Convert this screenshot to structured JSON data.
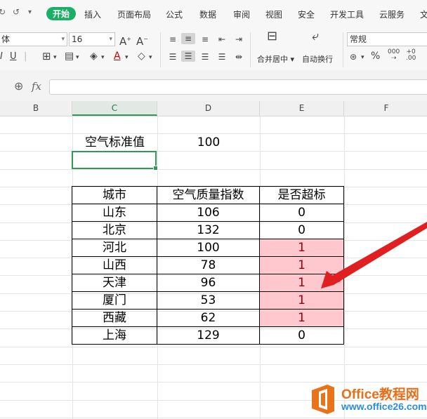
{
  "colors": {
    "accent_green": "#1aae66",
    "selection_green": "#2f9a54",
    "highlight_fill": "#ffc7ce",
    "highlight_text": "#9c0006",
    "arrow_red": "#e02020"
  },
  "menubar": {
    "tabs": [
      {
        "label": "开始",
        "active": true
      },
      {
        "label": "插入"
      },
      {
        "label": "页面布局"
      },
      {
        "label": "公式"
      },
      {
        "label": "数据"
      },
      {
        "label": "审阅"
      },
      {
        "label": "视图"
      },
      {
        "label": "安全"
      },
      {
        "label": "开发工具"
      },
      {
        "label": "云服务"
      },
      {
        "label": "文"
      }
    ]
  },
  "ribbon": {
    "font_name": "体",
    "font_size": "16",
    "merge_center_label": "合并居中",
    "auto_wrap_label": "自动换行",
    "number_format": "常规",
    "percent_symbol": "%"
  },
  "formula_bar": {
    "fx_label": "fx",
    "value": ""
  },
  "columns": [
    "B",
    "C",
    "D",
    "E",
    "F"
  ],
  "selected_column": "C",
  "sheet": {
    "threshold_label": "空气标准值",
    "threshold_value": "100",
    "table": {
      "headers": [
        "城市",
        "空气质量指数",
        "是否超标"
      ],
      "rows": [
        {
          "city": "山东",
          "aqi": "106",
          "flag": "0",
          "highlight": false
        },
        {
          "city": "北京",
          "aqi": "132",
          "flag": "0",
          "highlight": false
        },
        {
          "city": "河北",
          "aqi": "100",
          "flag": "1",
          "highlight": true
        },
        {
          "city": "山西",
          "aqi": "78",
          "flag": "1",
          "highlight": true
        },
        {
          "city": "天津",
          "aqi": "96",
          "flag": "1",
          "highlight": true
        },
        {
          "city": "厦门",
          "aqi": "53",
          "flag": "1",
          "highlight": true
        },
        {
          "city": "西藏",
          "aqi": "62",
          "flag": "1",
          "highlight": true
        },
        {
          "city": "上海",
          "aqi": "129",
          "flag": "0",
          "highlight": false
        }
      ]
    }
  },
  "watermark": {
    "title": "Office教程网",
    "url": "www.office26.com"
  }
}
